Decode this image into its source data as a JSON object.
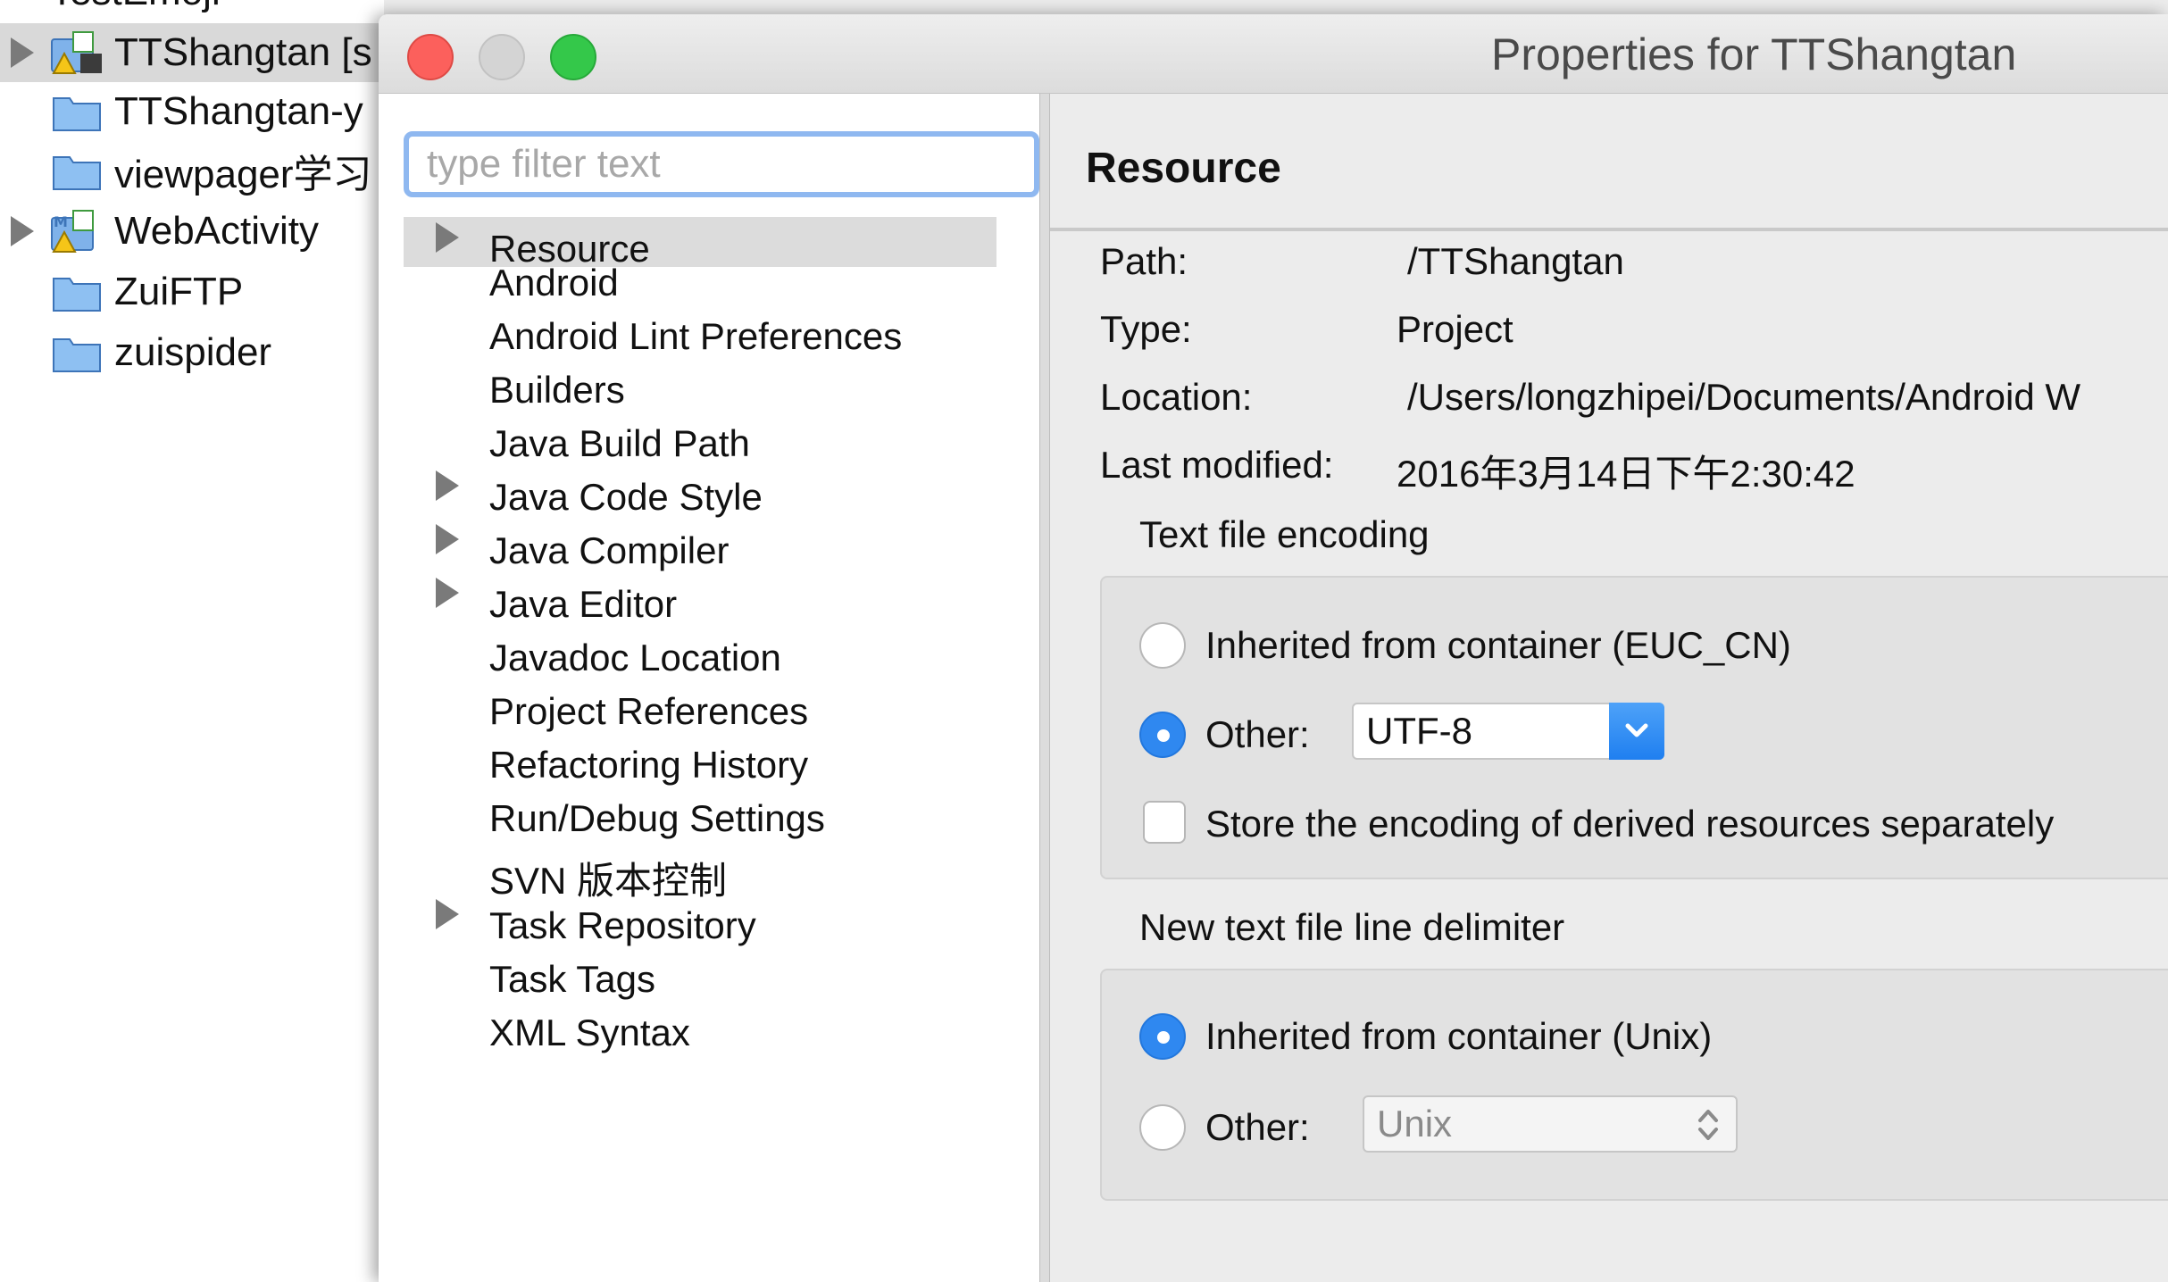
{
  "explorer": {
    "top_partial": "TestEmoji",
    "items": [
      {
        "label": "TTShangtan [s",
        "expandable": true,
        "icon": "android-project-warning-icon"
      },
      {
        "label": "TTShangtan-y",
        "expandable": false,
        "icon": "folder-icon"
      },
      {
        "label": "viewpager学习",
        "expandable": false,
        "icon": "folder-icon"
      },
      {
        "label": "WebActivity",
        "expandable": true,
        "icon": "maven-project-warning-icon"
      },
      {
        "label": "ZuiFTP",
        "expandable": false,
        "icon": "folder-icon"
      },
      {
        "label": "zuispider",
        "expandable": false,
        "icon": "folder-icon"
      }
    ]
  },
  "dialog": {
    "title": "Properties for TTShangtan",
    "window_buttons": {
      "close": "close-icon",
      "minimize": "minimize-icon",
      "zoom": "zoom-icon"
    },
    "filter_placeholder": "type filter text",
    "nav": [
      {
        "label": "Resource",
        "expandable": true
      },
      {
        "label": "Android",
        "expandable": false
      },
      {
        "label": "Android Lint Preferences",
        "expandable": false
      },
      {
        "label": "Builders",
        "expandable": false
      },
      {
        "label": "Java Build Path",
        "expandable": false
      },
      {
        "label": "Java Code Style",
        "expandable": true
      },
      {
        "label": "Java Compiler",
        "expandable": true
      },
      {
        "label": "Java Editor",
        "expandable": true
      },
      {
        "label": "Javadoc Location",
        "expandable": false
      },
      {
        "label": "Project References",
        "expandable": false
      },
      {
        "label": "Refactoring History",
        "expandable": false
      },
      {
        "label": "Run/Debug Settings",
        "expandable": false
      },
      {
        "label": "SVN 版本控制",
        "expandable": false
      },
      {
        "label": "Task Repository",
        "expandable": true
      },
      {
        "label": "Task Tags",
        "expandable": false
      },
      {
        "label": "XML Syntax",
        "expandable": false
      }
    ],
    "page": {
      "heading": "Resource",
      "path_label": "Path:",
      "path_value": "/TTShangtan",
      "type_label": "Type:",
      "type_value": "Project",
      "location_label": "Location:",
      "location_value": "/Users/longzhipei/Documents/Android W",
      "modified_label": "Last modified:",
      "modified_value": "2016年3月14日下午2:30:42",
      "encoding": {
        "title": "Text file encoding",
        "inherited_label": "Inherited from container (EUC_CN)",
        "other_label": "Other:",
        "other_value": "UTF-8",
        "store_label": "Store the encoding of derived resources separately"
      },
      "delimiter": {
        "title": "New text file line delimiter",
        "inherited_label": "Inherited from container (Unix)",
        "other_label": "Other:",
        "other_value": "Unix"
      }
    }
  }
}
